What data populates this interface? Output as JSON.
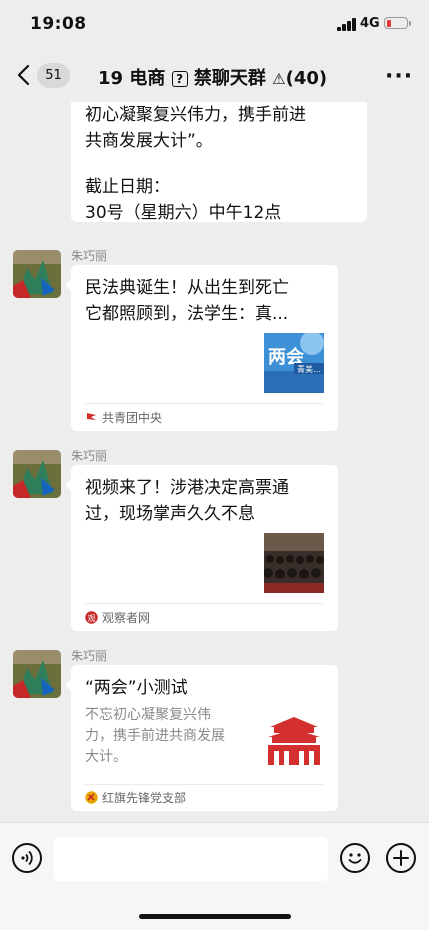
{
  "status_bar": {
    "time": "19:08",
    "network": "4G"
  },
  "nav": {
    "unread_count": "51",
    "title_prefix": "19 电商",
    "title_mark": "?",
    "title_suffix": "禁聊天群",
    "warning_glyph": "⚠",
    "member_count": "(40)"
  },
  "chat": {
    "previous_message": {
      "lines": [
        "初心凝聚复兴伟力，携手前进",
        "共商发展大计”。",
        "截止日期：",
        "30号（星期六）中午12点"
      ]
    },
    "messages": [
      {
        "sender": "朱巧丽",
        "title_lines": [
          "民法典诞生！从出生到死亡",
          "它都照顾到，法学生：真..."
        ],
        "thumb_text": "两会",
        "thumb_caption": "青美…",
        "source": "共青团中央"
      },
      {
        "sender": "朱巧丽",
        "title_lines": [
          "视频来了！涉港决定高票通",
          "过，现场掌声久久不息"
        ],
        "source": "观察者网"
      },
      {
        "sender": "朱巧丽",
        "title_lines": [
          "“两会”小测试"
        ],
        "desc_lines": [
          "不忘初心凝聚复兴伟",
          "力，携手前进共商发展",
          "大计。"
        ],
        "source": "红旗先锋党支部"
      }
    ]
  },
  "input_bar": {
    "placeholder": ""
  },
  "colors": {
    "background": "#ededed",
    "battery_low": "#e53935",
    "source_red": "#d32f2f"
  }
}
